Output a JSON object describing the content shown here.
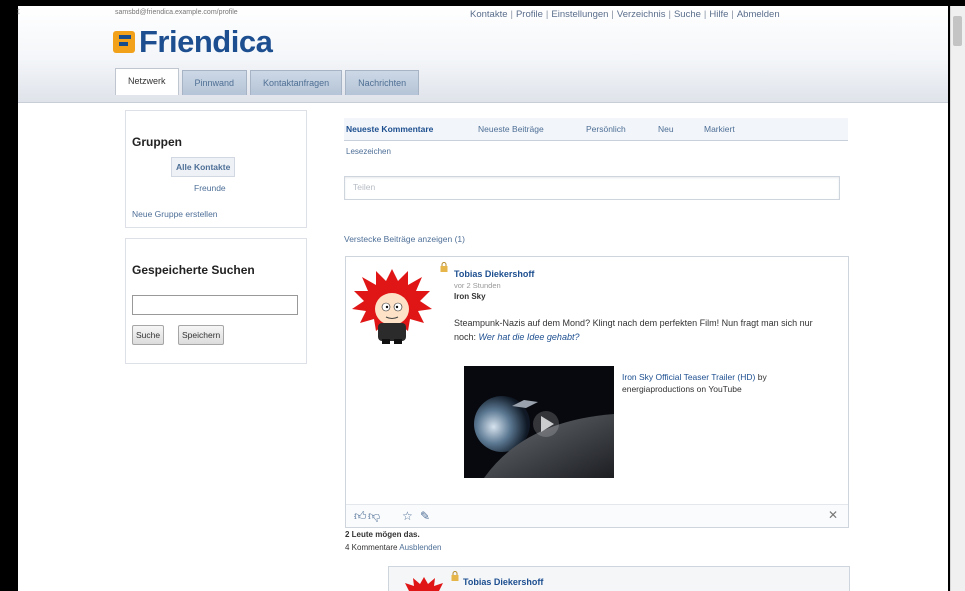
{
  "header": {
    "nick_line": "samsbd@friendica.example.com/profile",
    "logo_text": "Friendica",
    "nav": [
      "Kontakte",
      "Profile",
      "Einstellungen",
      "Verzeichnis",
      "Suche",
      "Hilfe",
      "Abmelden"
    ]
  },
  "tabs": [
    "Netzwerk",
    "Pinnwand",
    "Kontaktanfragen",
    "Nachrichten"
  ],
  "aside": {
    "groups_title": "Gruppen",
    "all_contacts": "Alle Kontakte",
    "friends": "Freunde",
    "new_group": "Neue Gruppe erstellen",
    "saved_search_title": "Gespeicherte Suchen",
    "search_button": "Suche",
    "save_button": "Speichern"
  },
  "network": {
    "subtabs": [
      "Neueste Kommentare",
      "Neueste Beiträge",
      "Persönlich",
      "Neu",
      "Markiert"
    ],
    "subnote": "Lesezeichen",
    "share_placeholder": "Teilen",
    "hidden_items": "Verstecke Beiträge anzeigen (1)"
  },
  "post": {
    "author": "Tobias Diekershoff",
    "date": "vor 2 Stunden",
    "title": "Iron Sky",
    "body_text": "Steampunk-Nazis auf dem Mond? Klingt nach dem perfekten Film! Nun fragt man sich nur noch:",
    "body_question": "Wer hat die Idee gehabt?",
    "video_link_text": "Iron Sky Official Teaser Trailer (HD)",
    "video_by": "by energiaproductions on YouTube",
    "likes_line": "2 Leute mögen das.",
    "comments_prefix": "4 Kommentare",
    "comments_link": "Ausblenden"
  },
  "post2": {
    "author": "Tobias Diekershoff"
  },
  "icons": {
    "like": "thumbs-up-icon",
    "dislike": "thumbs-down-icon",
    "star": "star-icon",
    "tag": "tag-icon",
    "close": "close-icon"
  }
}
